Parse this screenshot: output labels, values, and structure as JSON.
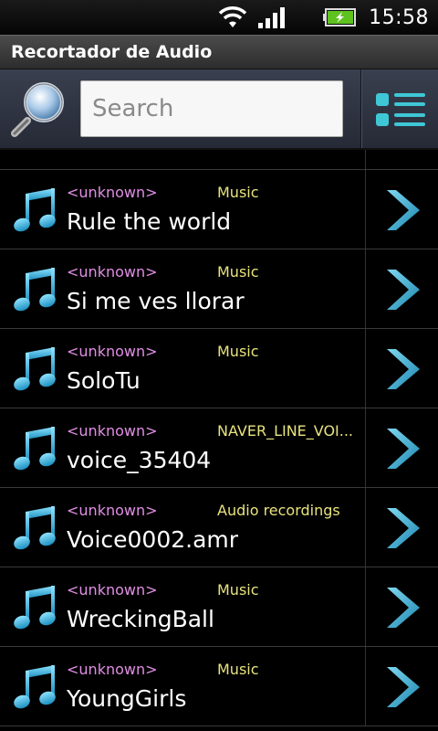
{
  "status_bar": {
    "time": "15:58",
    "icons": [
      "wifi-icon",
      "signal-icon",
      "battery-charging-icon"
    ]
  },
  "app": {
    "title": "Recortador de Audio"
  },
  "search": {
    "placeholder": "Search",
    "value": ""
  },
  "list": {
    "items": [
      {
        "artist": "<unknown>",
        "album": "Music",
        "title": "Rule the world"
      },
      {
        "artist": "<unknown>",
        "album": "Music",
        "title": "Si me ves llorar"
      },
      {
        "artist": "<unknown>",
        "album": "Music",
        "title": "SoloTu"
      },
      {
        "artist": "<unknown>",
        "album": "NAVER_LINE_VOI...",
        "title": "voice_35404"
      },
      {
        "artist": "<unknown>",
        "album": "Audio recordings",
        "title": "Voice0002.amr"
      },
      {
        "artist": "<unknown>",
        "album": "Music",
        "title": "WreckingBall"
      },
      {
        "artist": "<unknown>",
        "album": "Music",
        "title": "YoungGirls"
      }
    ]
  },
  "colors": {
    "accent_cyan": "#3fb8e0",
    "artist_text": "#e28ee6",
    "album_text": "#e8e37e"
  }
}
